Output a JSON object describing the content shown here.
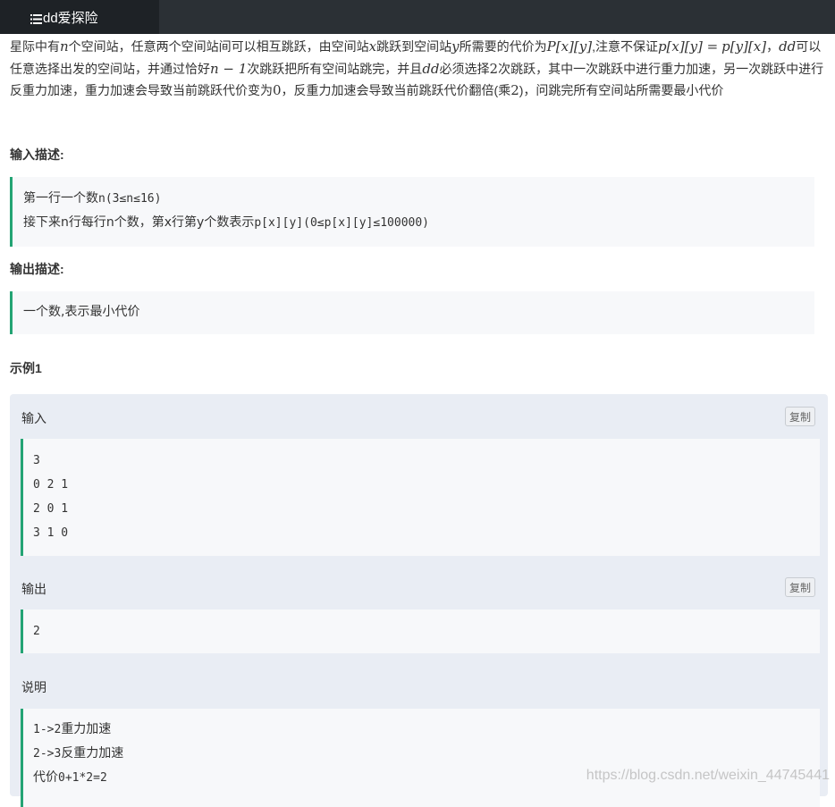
{
  "header": {
    "tab_title": "dd爱探险",
    "tab_icon": "list-icon"
  },
  "problem": {
    "description_parts": [
      "星际中有",
      "n",
      "个空间站，任意两个空间站间可以相互跳跃，由空间站",
      "x",
      "跳跃到空间站",
      "y",
      "所需要的代价为",
      "P[x][y]",
      ",注意不保证",
      "p[x][y] =",
      "p[y][x]",
      "，",
      "dd",
      "可以任意选择出发的空间站，并通过恰好",
      "n − 1",
      "次跳跃把所有空间站跳完，并且",
      "dd",
      "必须选择",
      "2",
      "次跳跃，其中一次跳跃中进行重力加速，另一次跳跃中进行反重力加速，重力加速会导致当前跳跃代价变为",
      "0",
      "，反重力加速会导致当前跳跃代价翻倍(乘",
      "2",
      ")，问跳完所有空间站所需要最小代价"
    ],
    "input_title": "输入描述:",
    "input_lines": [
      {
        "zh": "第一行一个数",
        "rest": "n(3≤n≤16)"
      },
      {
        "zh": "接下来n行每行n个数，第x行第y个数表示",
        "rest": "p[x][y](0≤p[x][y]≤100000)"
      }
    ],
    "output_title": "输出描述:",
    "output_line": "一个数,表示最小代价",
    "example_title": "示例1",
    "example": {
      "input_label": "输入",
      "copy_label": "复制",
      "input_lines": [
        "3",
        "0 2 1",
        "2 0 1",
        "3 1 0"
      ],
      "output_label": "输出",
      "output_lines": [
        "2"
      ],
      "explain_label": "说明",
      "explain_lines": [
        {
          "a": "1->2",
          "b": "重力加速"
        },
        {
          "a": "2->3",
          "b": "反重力加速"
        },
        {
          "a": "代价",
          "b": "0+1*2=2"
        }
      ]
    }
  },
  "watermark": "https://blog.csdn.net/weixin_44745441"
}
